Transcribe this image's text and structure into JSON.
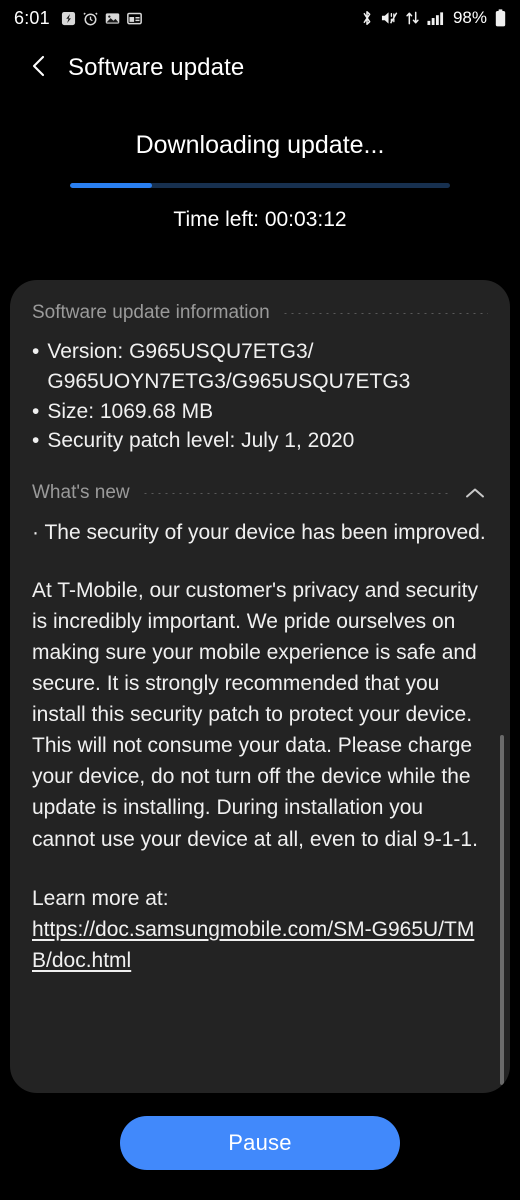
{
  "statusbar": {
    "time": "6:01",
    "battery_percent": "98%",
    "left_icons": [
      {
        "name": "download-notification-icon"
      },
      {
        "name": "alarm-clock-icon"
      },
      {
        "name": "photo-gallery-icon"
      },
      {
        "name": "calendar-icon"
      }
    ],
    "right_icons": [
      {
        "name": "bluetooth-icon"
      },
      {
        "name": "sound-mute-icon"
      },
      {
        "name": "data-transfer-icon"
      },
      {
        "name": "signal-bars-icon"
      },
      {
        "name": "battery-icon"
      }
    ]
  },
  "titlebar": {
    "back_icon": "chevron-left-icon",
    "title": "Software update"
  },
  "download": {
    "heading": "Downloading update...",
    "progress_percent": 21.5,
    "time_left": "Time left: 00:03:12"
  },
  "info_card": {
    "section_title": "Software update information",
    "bullet_marker": "•",
    "bullets": [
      "Version: G965USQU7ETG3/ G965UOYN7ETG3/G965USQU7ETG3",
      "Size: 1069.68 MB",
      "Security patch level: July 1, 2020"
    ],
    "whats_new_title": "What's new",
    "whats_new_collapse_icon": "chevron-up-icon",
    "whats_new_first_line": "· The security of your device has been improved.",
    "whats_new_paragraph_1": "At T-Mobile, our customer's privacy and security is incredibly important. We pride ourselves on making sure your mobile experience is safe and secure. It is strongly recommended that you install this security patch to protect your device.",
    "whats_new_paragraph_2": " This will not consume your data.  Please charge your device,  do not turn off the device while the update is installing. During installation you cannot use your device at all, even to dial 9-1-1.",
    "learn_more_label": "Learn more at:",
    "learn_more_url": "https://doc.samsungmobile.com/SM-G965U/TMB/doc.html"
  },
  "actions": {
    "pause_label": "Pause"
  },
  "colors": {
    "accent_blue": "#4189fb",
    "progress_fill": "#2a7ff0",
    "progress_track": "#17304f",
    "card_background": "#232323",
    "page_background": "#000000",
    "muted_text": "#9a9a9a"
  }
}
